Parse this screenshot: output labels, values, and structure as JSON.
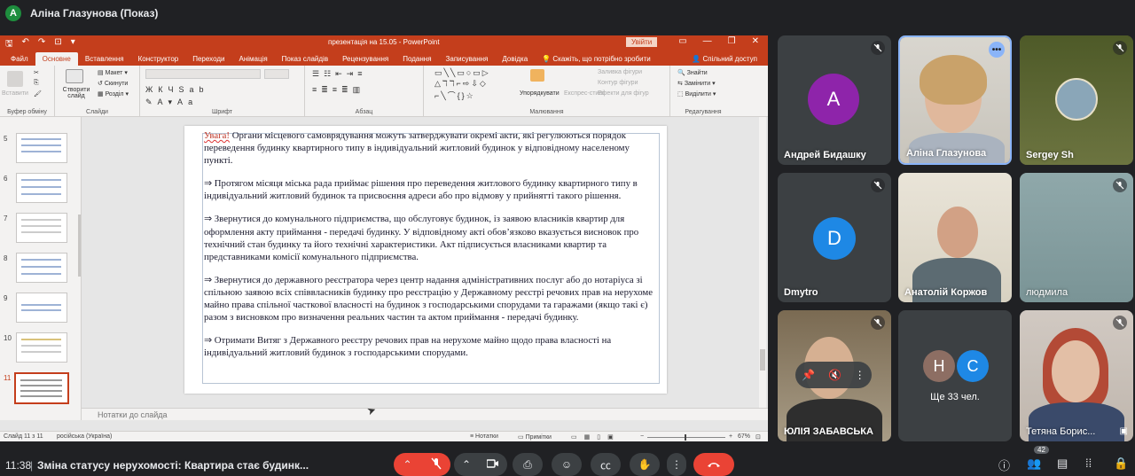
{
  "meet": {
    "presenter_initial": "A",
    "presenter_label": "Аліна Глазунова (Показ)",
    "time": "11:38",
    "separator": "|",
    "meeting_title": "Зміна статусу нерухомості: Квартира стає будинк...",
    "participants_badge": "42",
    "more_count_label": "Ще 33 чел.",
    "more_initials": [
      "Н",
      "С"
    ]
  },
  "participants": [
    {
      "name": "Андрей Бидашку",
      "initial": "A",
      "avatar_color": "#8e24aa",
      "muted": true
    },
    {
      "name": "Аліна Глазунова",
      "muted": false,
      "speaking": true
    },
    {
      "name": "Sergey Sh",
      "muted": true
    },
    {
      "name": "Dmytro",
      "initial": "D",
      "avatar_color": "#1e88e5",
      "muted": true
    },
    {
      "name": "Анатолій Коржов",
      "muted": false
    },
    {
      "name": "людмила",
      "muted": true
    },
    {
      "name": "ЮЛІЯ ЗАБАВСЬКА",
      "muted": true
    },
    {
      "name": "Тетяна Борис...",
      "muted": true
    }
  ],
  "ppt": {
    "doc_title": "презентація на 15.05  -  PowerPoint",
    "signin": "Увійти",
    "tabs": [
      "Файл",
      "Основне",
      "Вставлення",
      "Конструктор",
      "Переходи",
      "Анімація",
      "Показ слайдів",
      "Рецензування",
      "Подання",
      "Записування",
      "Довідка"
    ],
    "tell_me": "Скажіть, що потрібно зробити",
    "share": "Спільний доступ",
    "ribbon": {
      "paste": "Вставити",
      "clipboard_group": "Буфер обміну",
      "new_slide": "Створити слайд",
      "layout": "Макет",
      "reset": "Скинути",
      "section": "Розділ",
      "slides_group": "Слайди",
      "font_group": "Шрифт",
      "paragraph_group": "Абзац",
      "arrange": "Упорядкувати",
      "quick_styles": "Експрес-стилі",
      "shape_fill": "Заливка фігури",
      "shape_outline": "Контур фігури",
      "shape_effects": "Ефекти для фігур",
      "drawing_group": "Малювання",
      "find": "Знайти",
      "replace": "Замінити",
      "select": "Виділити",
      "editing_group": "Редагування"
    },
    "thumb_numbers": [
      "5",
      "6",
      "7",
      "8",
      "9",
      "10",
      "11"
    ],
    "notes_placeholder": "Нотатки до слайда",
    "status": {
      "slide": "Слайд 11 з 11",
      "language": "російська (Україна)",
      "notes": "Нотатки",
      "comments": "Примітки",
      "zoom": "67%"
    },
    "slide": {
      "p1_warn": "Увага!",
      "p1": " Органи місцевого самоврядування можуть затверджувати окремі акти, які регулюються порядок переведення будинку квартирного типу в індивідуальний житловий будинок у відповідному населеному пункті.",
      "p2": "⇒ Протягом місяця міська рада приймає рішення про переведення житлового будинку квартирного типу в індивідуальний житловий будинок та присвоєння адреси або про відмову у прийнятті такого рішення.",
      "p3": "⇒ Звернутися до комунального підприємства, що обслуговує будинок, із заявою власників квартир для оформлення акту приймання - передачі будинку. У відповідному акті обов’язково вказується висновок про технічний стан будинку та його технічні характеристики. Акт підписується власниками квартир та представниками комісії комунального підприємства.",
      "p4": "⇒ Звернутися до державного реєстратора через центр надання адміністративних послуг або до нотаріуса зі спільною заявою всіх співвласників будинку про реєстрацію у Державному реєстрі речових прав на нерухоме майно права спільної часткової власності на будинок з господарськими спорудами та гаражами (якщо такі є) разом з висновком про визначення реальних частин та актом приймання - передачі будинку.",
      "p5": "⇒ Отримати Витяг з Державного реєстру речових прав на нерухоме майно щодо права власності на індивідуальний житловий будинок з господарськими спорудами."
    }
  }
}
